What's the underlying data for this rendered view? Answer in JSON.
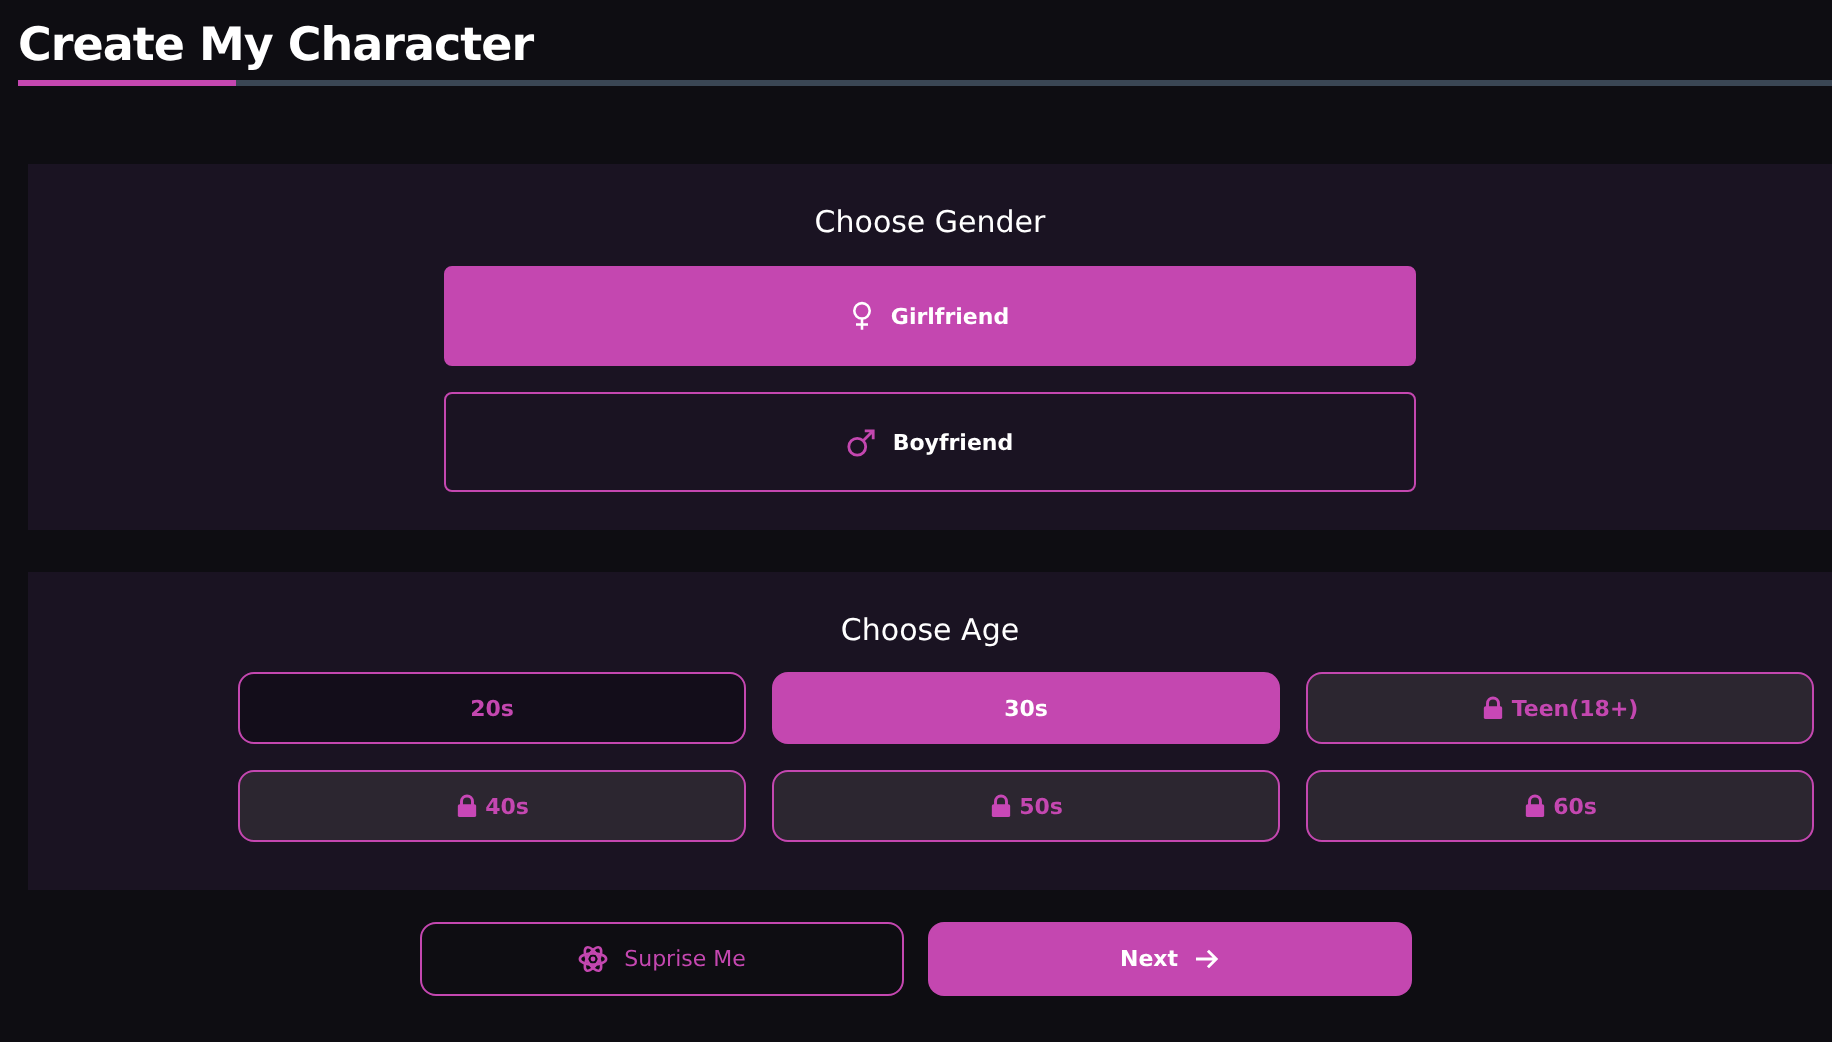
{
  "title": "Create My Character",
  "progress": {
    "level": 0.12
  },
  "gender": {
    "heading": "Choose Gender",
    "options": [
      {
        "label": "Girlfriend",
        "kind": "female",
        "selected": true
      },
      {
        "label": "Boyfriend",
        "kind": "male",
        "selected": false
      }
    ]
  },
  "age": {
    "heading": "Choose Age",
    "options": [
      {
        "label": "20s",
        "selected": false,
        "locked": false
      },
      {
        "label": "30s",
        "selected": true,
        "locked": false
      },
      {
        "label": "Teen(18+)",
        "selected": false,
        "locked": true
      },
      {
        "label": "40s",
        "selected": false,
        "locked": true
      },
      {
        "label": "50s",
        "selected": false,
        "locked": true
      },
      {
        "label": "60s",
        "selected": false,
        "locked": true
      }
    ]
  },
  "buttons": [
    {
      "label": "Suprise Me",
      "kind": "secondary"
    },
    {
      "label": "Next",
      "kind": "primary"
    }
  ]
}
